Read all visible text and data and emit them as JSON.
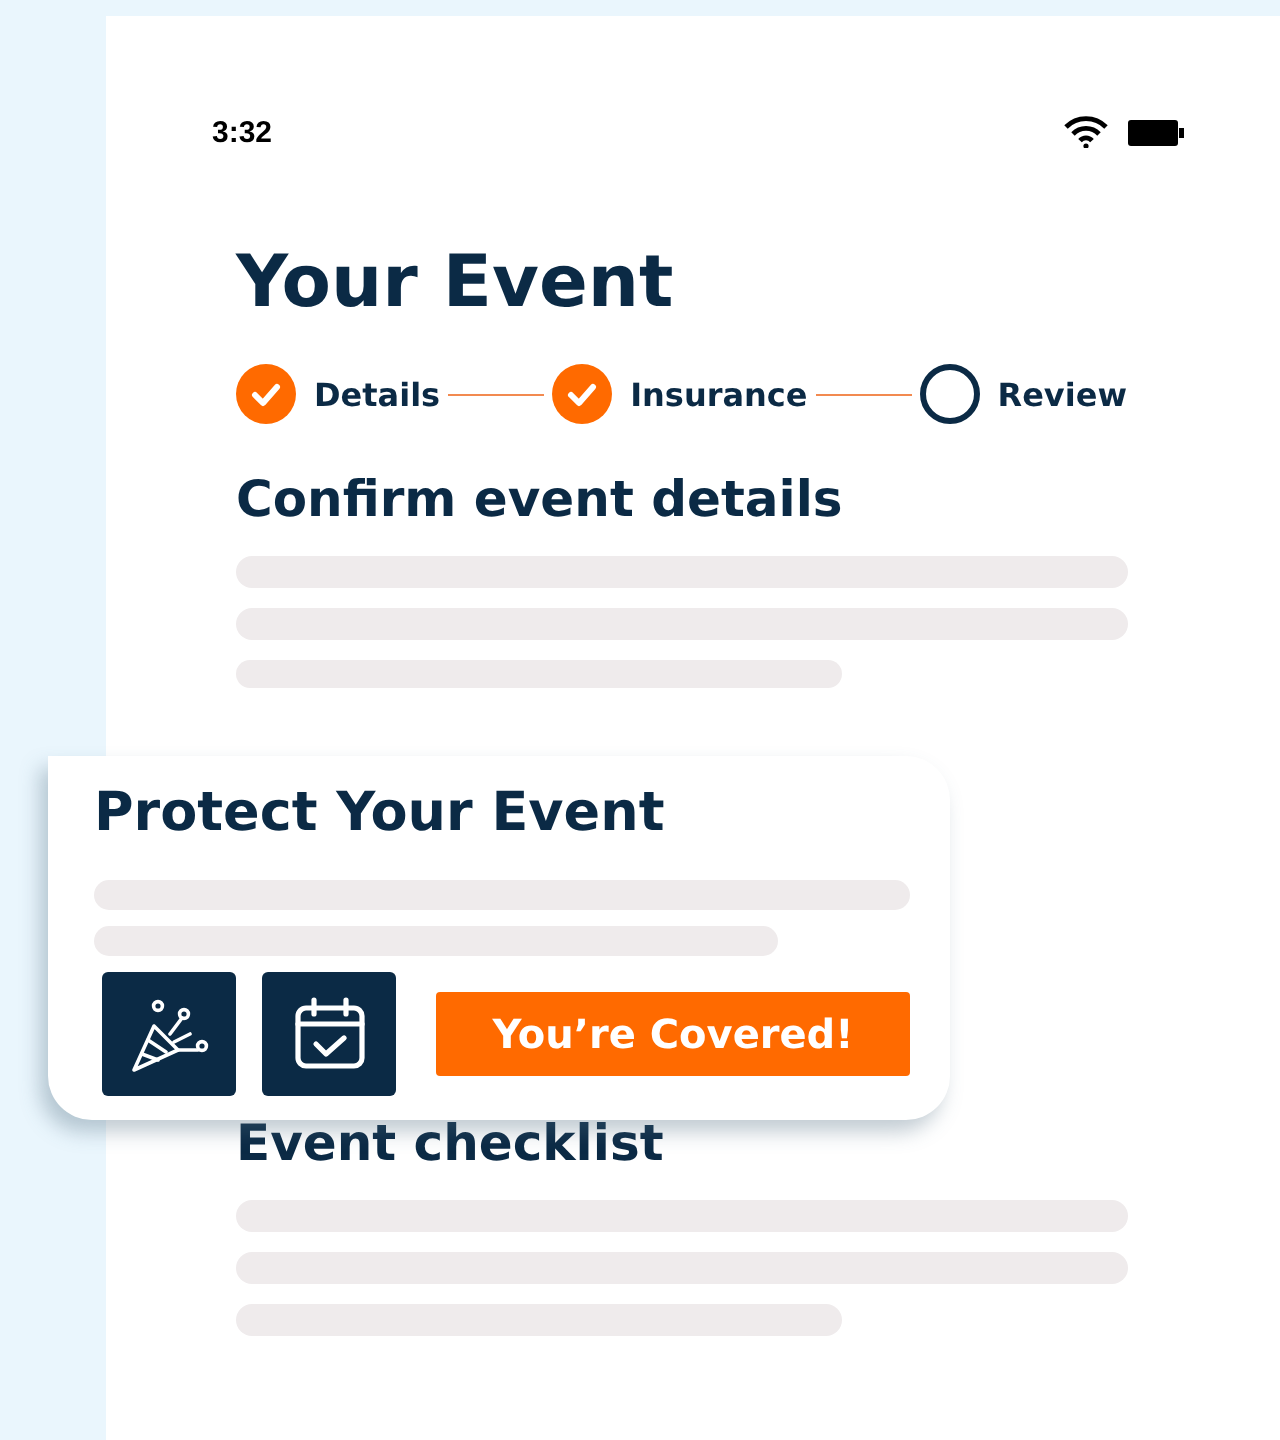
{
  "status_bar": {
    "time": "3:32"
  },
  "title": "Your Event",
  "steps": [
    {
      "label": "Details",
      "done": true
    },
    {
      "label": "Insurance",
      "done": true
    },
    {
      "label": "Review",
      "done": false
    }
  ],
  "sections": [
    {
      "heading": "Confirm event details"
    },
    {
      "heading": "Event checklist"
    }
  ],
  "card": {
    "title": "Protect Your Event",
    "badge": "You’re Covered!"
  }
}
